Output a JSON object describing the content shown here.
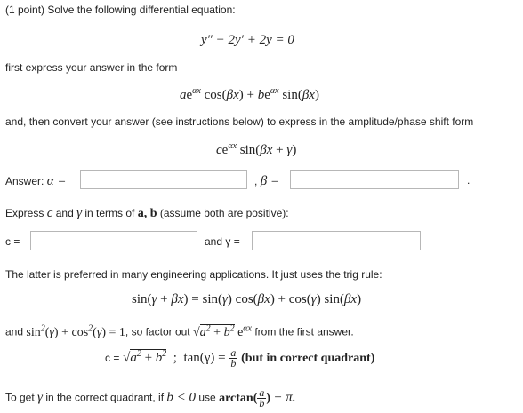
{
  "problem": {
    "header": "(1 point) Solve the following differential equation:",
    "equation": "y″ − 2y′ + 2y = 0",
    "form1_intro": "first express your answer in the form",
    "form1": "ae^{αx} cos(βx) + be^{αx} sin(βx)",
    "form2_intro": "and, then convert your answer (see instructions below) to express in the amplitude/phase shift form",
    "form2": "ce^{αx} sin(βx + γ)"
  },
  "answer": {
    "label_prefix": "Answer:",
    "alpha_symbol": "α =",
    "beta_separator": ",",
    "beta_symbol": "β =",
    "trailing_period": ".",
    "alpha_value": "",
    "beta_value": ""
  },
  "express": {
    "text_start": "Express",
    "c_symbol": "c",
    "text_and": "and",
    "gamma_symbol": "γ",
    "text_in_terms": "in terms of",
    "ab_symbols": "a, b",
    "text_assume": "(assume both are positive):",
    "c_label": "c =",
    "gamma_label": "and γ =",
    "c_value": "",
    "gamma_value": ""
  },
  "explanation": {
    "latter_text": "The latter is preferred in many engineering applications. It just uses the trig rule:",
    "trig_rule": "sin(γ + βx) = sin(γ) cos(βx) + cos(γ) sin(βx)",
    "factor_text_1": "and",
    "factor_identity": "sin²(γ) + cos²(γ) = 1",
    "factor_text_2": ", so factor out",
    "factor_text_3": "from the first answer.",
    "c_formula_lhs": "c =",
    "tan_formula": "tan(γ) =",
    "quadrant_note": "(but in correct quadrant)",
    "gamma_text_1": "To get",
    "gamma_text_2": "in the correct quadrant, if",
    "gamma_condition": "b < 0",
    "gamma_text_3": "use",
    "gamma_plus": "+ π."
  }
}
